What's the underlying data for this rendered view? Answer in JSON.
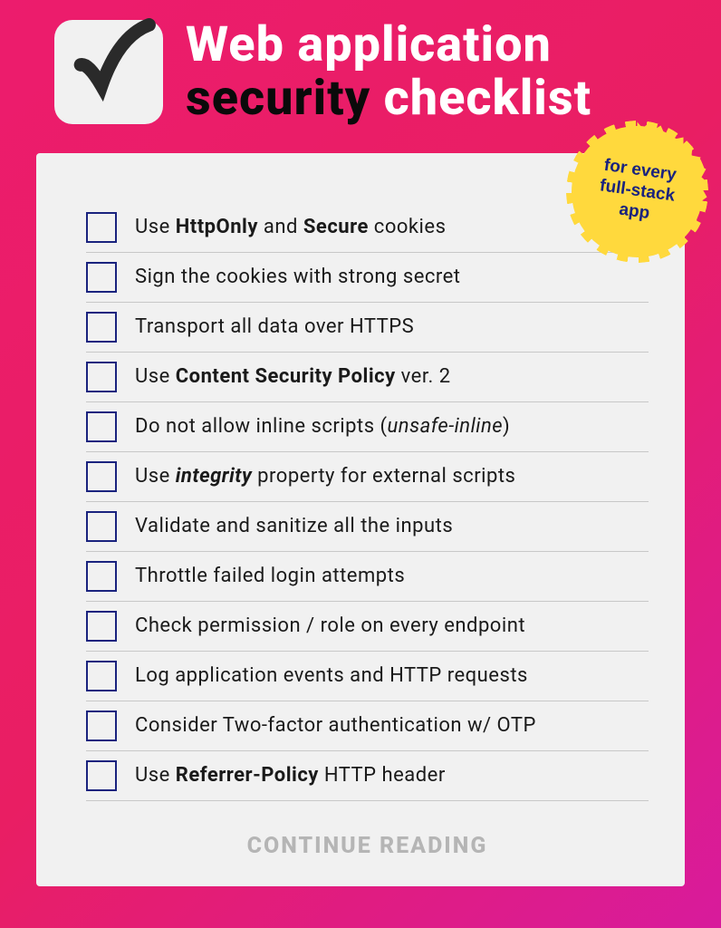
{
  "header": {
    "title_line1": "Web application",
    "title_emphasis": "security",
    "title_line2_rest": " checklist"
  },
  "badge": {
    "line1": "for every",
    "line2": "full-stack",
    "line3": "app"
  },
  "checklist": {
    "items": [
      {
        "html": "Use <strong>HttpOnly</strong> and <strong>Secure</strong> cookies"
      },
      {
        "html": "Sign the cookies with strong secret"
      },
      {
        "html": "Transport all data over HTTPS"
      },
      {
        "html": "Use <strong>Content Security Policy</strong> ver. 2"
      },
      {
        "html": "Do not allow inline scripts (<em>unsafe-inline</em>)"
      },
      {
        "html": "Use <span class='bold-italic'>integrity</span> property for external scripts"
      },
      {
        "html": "Validate and sanitize all the inputs"
      },
      {
        "html": "Throttle failed login attempts"
      },
      {
        "html": "Check permission / role on every endpoint"
      },
      {
        "html": "Log application events and HTTP requests"
      },
      {
        "html": "Consider Two-factor authentication w/ OTP"
      },
      {
        "html": "Use <strong>Referrer-Policy</strong> HTTP header"
      }
    ]
  },
  "footer": {
    "continue": "CONTINUE READING"
  }
}
